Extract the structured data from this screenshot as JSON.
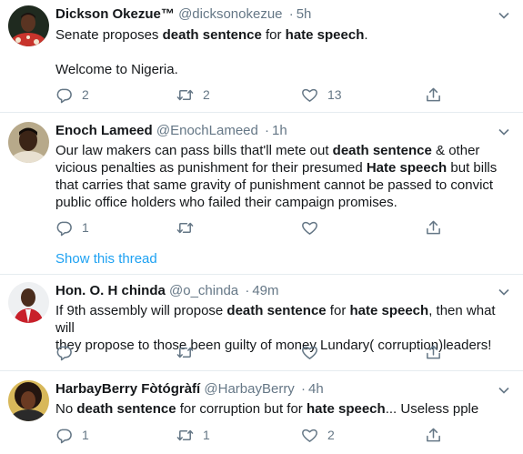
{
  "tweets": [
    {
      "name": "Dickson Okezue™",
      "handle": "@dicksonokezue",
      "separator": "·",
      "time": "5h",
      "lines": [
        [
          {
            "t": "Senate proposes "
          },
          {
            "t": "death sentence",
            "b": true
          },
          {
            "t": " for "
          },
          {
            "t": "hate speech",
            "b": true
          },
          {
            "t": "."
          }
        ],
        [],
        [
          {
            "t": "Welcome to Nigeria."
          }
        ]
      ],
      "replies": "2",
      "retweets": "2",
      "likes": "13"
    },
    {
      "name": "Enoch Lameed",
      "handle": "@EnochLameed",
      "separator": "·",
      "time": "1h",
      "lines": [
        [
          {
            "t": "Our law makers can pass bills that'll mete out "
          },
          {
            "t": "death sentence",
            "b": true
          },
          {
            "t": " & other"
          }
        ],
        [
          {
            "t": "vicious penalties as punishment for their presumed "
          },
          {
            "t": "Hate speech",
            "b": true
          },
          {
            "t": " but bills"
          }
        ],
        [
          {
            "t": "that carries that same gravity of punishment cannot be passed to convict"
          }
        ],
        [
          {
            "t": "public office holders who failed their campaign promises."
          }
        ]
      ],
      "replies": "1",
      "retweets": "",
      "likes": "",
      "show_thread": "Show this thread"
    },
    {
      "name": "Hon. O. H chinda",
      "handle": "@o_chinda",
      "separator": "·",
      "time": "49m",
      "lines": [
        [
          {
            "t": "If 9th assembly will propose "
          },
          {
            "t": "death sentence",
            "b": true
          },
          {
            "t": " for "
          },
          {
            "t": "hate speech",
            "b": true
          },
          {
            "t": ", then what will"
          }
        ],
        [
          {
            "t": "they propose to those been guilty of money Lundary( corruption)leaders!"
          }
        ]
      ],
      "replies": "",
      "retweets": "",
      "likes": ""
    },
    {
      "name": "HarbayBerry Fòtógràfí",
      "handle": "@HarbayBerry",
      "separator": "·",
      "time": "4h",
      "lines": [
        [
          {
            "t": "No "
          },
          {
            "t": "death sentence",
            "b": true
          },
          {
            "t": " for corruption but for "
          },
          {
            "t": "hate speech",
            "b": true
          },
          {
            "t": "... Useless pple"
          }
        ]
      ],
      "replies": "1",
      "retweets": "1",
      "likes": "2"
    }
  ],
  "icons": {
    "reply": "reply-icon",
    "retweet": "retweet-icon",
    "like": "like-icon",
    "share": "share-icon",
    "caret": "chevron-down-icon"
  },
  "colors": {
    "text": "#14171a",
    "secondary": "#657786",
    "link": "#1da1f2",
    "border": "#e6ecf0"
  }
}
